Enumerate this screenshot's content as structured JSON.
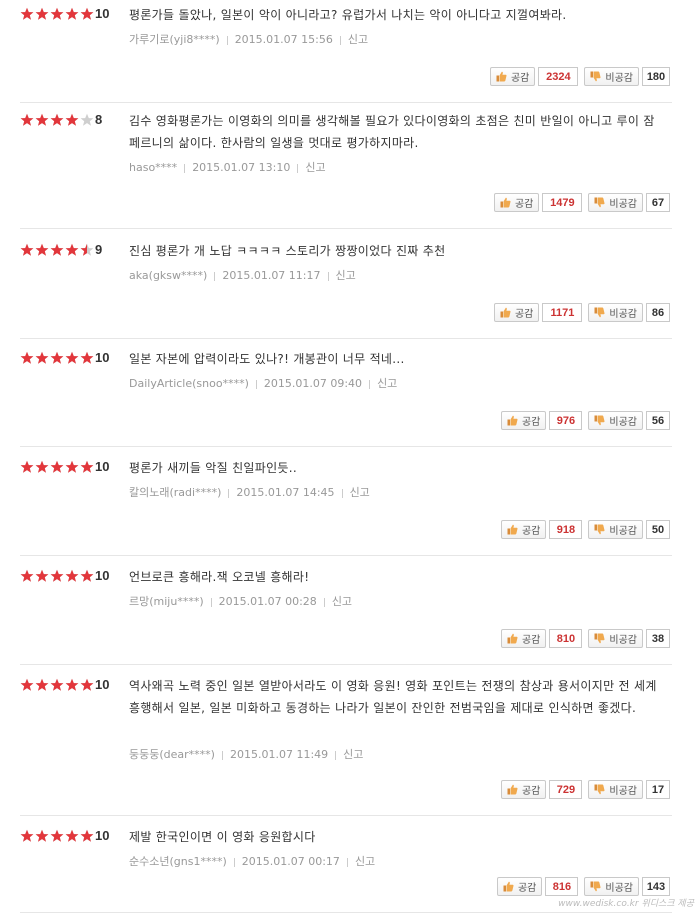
{
  "labels": {
    "like": "공감",
    "dislike": "비공감",
    "report": "신고"
  },
  "watermark": "www.wedisk.co.kr 위디스크 제공",
  "colors": {
    "star_on": "#e2363b",
    "star_off": "#cfcfcf",
    "like_count": "#cc3333"
  },
  "reviews": [
    {
      "stars": 5,
      "score": "10",
      "text": "평론가들 돌았나, 일본이 악이 아니라고? 유럽가서 나치는 악이 아니다고 지껄여봐라.",
      "author": "가루기로(yji8****)",
      "date": "2015.01.07 15:56",
      "likes": "2324",
      "dislikes": "180"
    },
    {
      "stars": 4,
      "score": "8",
      "text": "김수 영화평론가는 이영화의 의미를 생각해볼 필요가 있다이영화의 초점은 친미 반일이 아니고 루이 잠페르니의 삶이다. 한사람의 일생을 멋대로 평가하지마라.",
      "author": "haso****",
      "date": "2015.01.07 13:10",
      "likes": "1479",
      "dislikes": "67"
    },
    {
      "stars": 4.5,
      "score": "9",
      "text": "진심 평론가 개 노답 ㅋㅋㅋㅋ 스토리가 짱짱이었다 진짜 추천",
      "author": "aka(gksw****)",
      "date": "2015.01.07 11:17",
      "likes": "1171",
      "dislikes": "86"
    },
    {
      "stars": 5,
      "score": "10",
      "text": "일본 자본에 압력이라도 있나?! 개봉관이 너무 적네...",
      "author": "DailyArticle(snoo****)",
      "date": "2015.01.07 09:40",
      "likes": "976",
      "dislikes": "56"
    },
    {
      "stars": 5,
      "score": "10",
      "text": "평론가 새끼들 악질 친일파인듯..",
      "author": "칼의노래(radi****)",
      "date": "2015.01.07 14:45",
      "likes": "918",
      "dislikes": "50"
    },
    {
      "stars": 5,
      "score": "10",
      "text": "언브로큰 흥해라.잭 오코넬 흥해라!",
      "author": "르망(miju****)",
      "date": "2015.01.07 00:28",
      "likes": "810",
      "dislikes": "38"
    },
    {
      "stars": 5,
      "score": "10",
      "text": "역사왜곡 노력 중인 일본 열받아서라도 이 영화 응원! 영화 포인트는 전쟁의 참상과 용서이지만 전 세계 흥행해서 일본, 일본 미화하고 동경하는 나라가 일본이 잔인한 전범국임을 제대로 인식하면 좋겠다.",
      "author": "둥둥둥(dear****)",
      "date": "2015.01.07 11:49",
      "likes": "729",
      "dislikes": "17"
    },
    {
      "stars": 5,
      "score": "10",
      "text": "제발 한국인이면 이 영화 응원합시다",
      "author": "순수소년(gns1****)",
      "date": "2015.01.07 00:17",
      "likes": "816",
      "dislikes": "143"
    }
  ]
}
